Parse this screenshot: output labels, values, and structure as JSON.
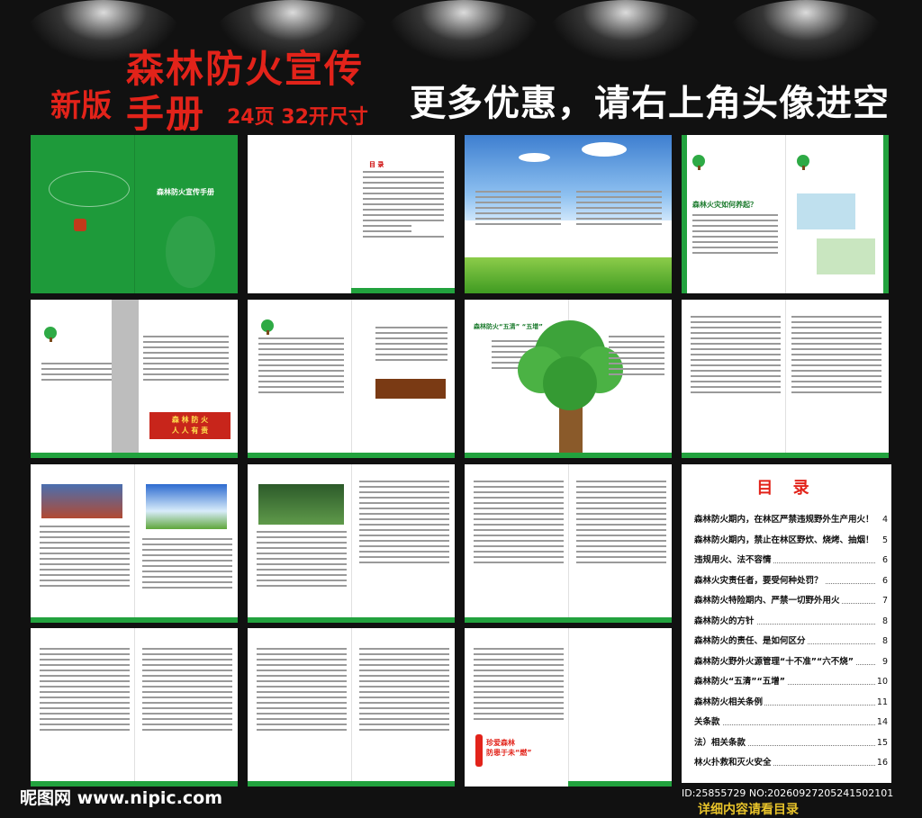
{
  "header": {
    "new_edition": "新版",
    "title_line1": "森林防火宣传",
    "title_line2": "手册",
    "spec": "24页 32开尺寸",
    "promo": "更多优惠，请右上角头像进空间"
  },
  "spreads": {
    "cover_title": "森林防火宣传手册",
    "toc_small": "目 录",
    "slogan_box_line1": "森 林 防 火",
    "slogan_box_line2": "人 人 有 责",
    "tree_label": "森林防火“五清” “五增”",
    "match_slogan_line1": "珍爱森林",
    "match_slogan_line2": "防患于未“燃”",
    "qa_heading": "森林火灾如何养起？"
  },
  "toc": {
    "title": "目 录",
    "items": [
      {
        "label": "森林防火期内，在林区严禁违规野外生产用火！",
        "page": "4"
      },
      {
        "label": "森林防火期内，禁止在林区野炊、烧烤、抽烟！",
        "page": "5"
      },
      {
        "label": "违规用火、法不容情",
        "page": "6"
      },
      {
        "label": "森林火灾责任者，要受何种处罚？",
        "page": "6"
      },
      {
        "label": "森林防火特险期内、严禁一切野外用火",
        "page": "7"
      },
      {
        "label": "森林防火的方针",
        "page": "8"
      },
      {
        "label": "森林防火的责任、是如何区分",
        "page": "8"
      },
      {
        "label": "森林防火野外火源管理“十不准”“六不烧”",
        "page": "9"
      },
      {
        "label": "森林防火“五清”“五增”",
        "page": "10"
      },
      {
        "label": "森林防火相关条例",
        "page": "11"
      },
      {
        "label": "关条款",
        "page": "14"
      },
      {
        "label": "法）相关条款",
        "page": "15"
      },
      {
        "label": "林火扑救和灭火安全",
        "page": "16"
      }
    ]
  },
  "footer": {
    "watermark": "昵图网 www.nipic.com",
    "id_text": "ID:25855729 NO:20260927205241502101",
    "detail_text": "详细内容请看目录"
  },
  "colors": {
    "brand_green": "#22a23e",
    "title_red": "#e2231a",
    "background": "#111111"
  }
}
